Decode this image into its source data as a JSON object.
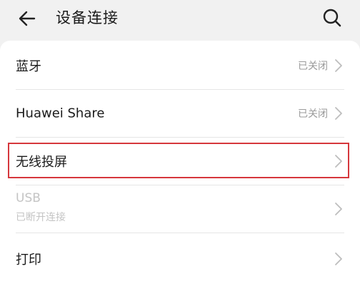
{
  "header": {
    "title": "设备连接",
    "back_icon": "arrow-left-icon",
    "search_icon": "search-icon"
  },
  "items": [
    {
      "label": "蓝牙",
      "status": "已关闭",
      "enabled": true
    },
    {
      "label": "Huawei Share",
      "status": "已关闭",
      "enabled": true
    },
    {
      "label": "无线投屏",
      "status": "",
      "enabled": true,
      "highlighted": true
    },
    {
      "label": "USB",
      "sublabel": "已断开连接",
      "enabled": false
    },
    {
      "label": "打印",
      "status": "",
      "enabled": true
    }
  ],
  "colors": {
    "background": "#f1f1f1",
    "card": "#ffffff",
    "highlight_border": "#d6373c",
    "secondary_text": "#9a9a9a",
    "disabled_text": "#c4c4c4"
  }
}
